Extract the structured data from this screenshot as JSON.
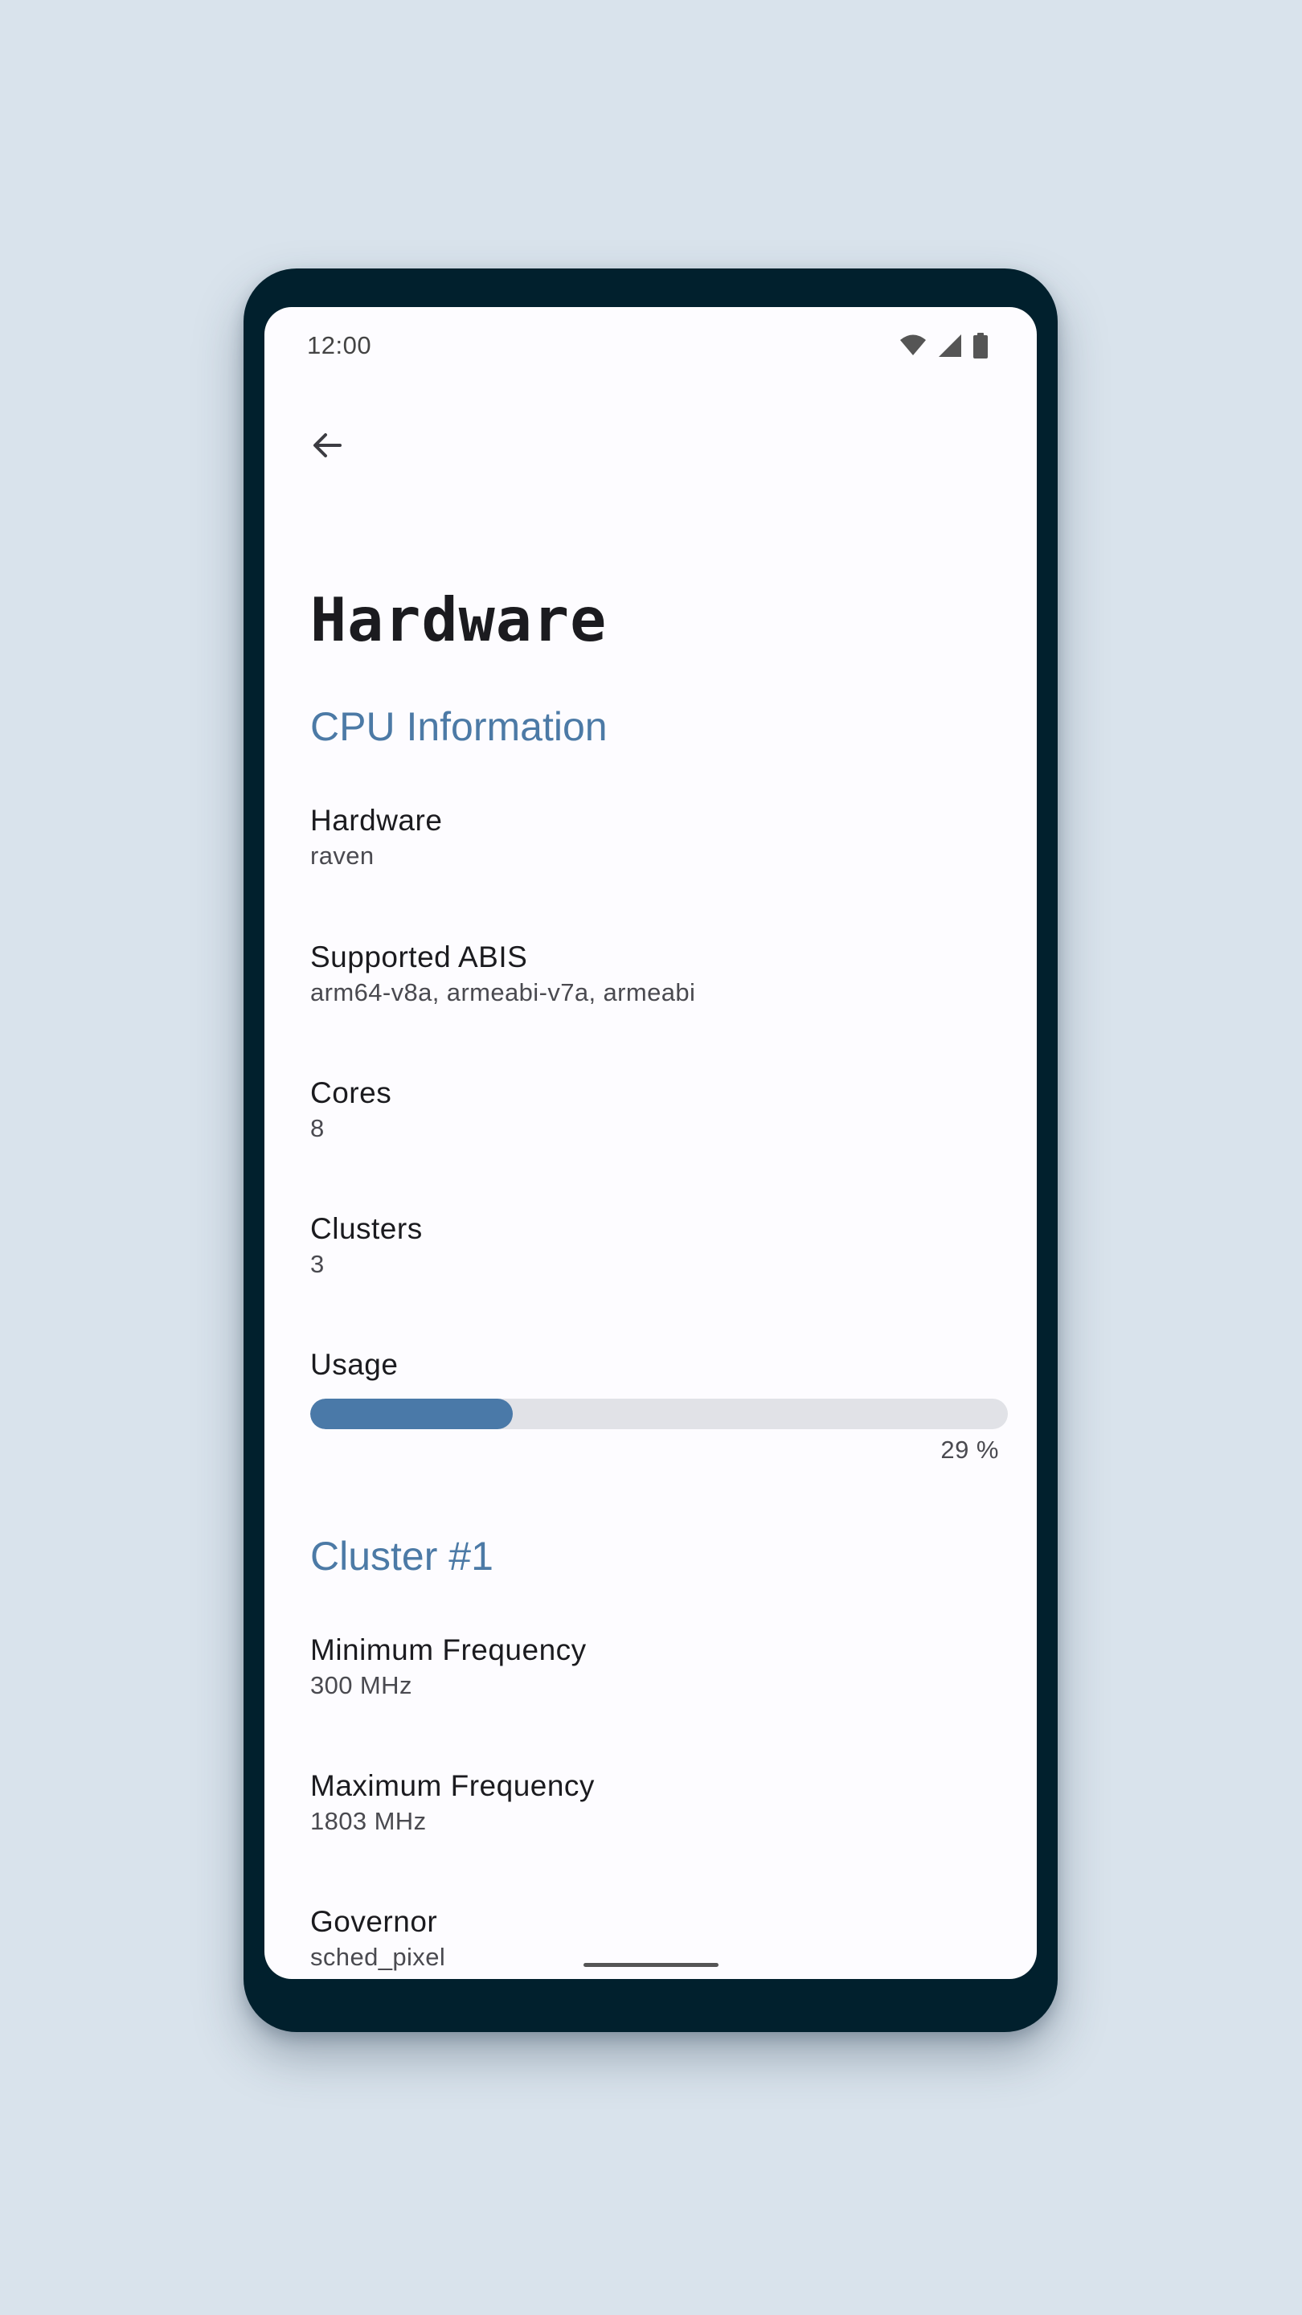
{
  "status_bar": {
    "time": "12:00",
    "icons": [
      "wifi-icon",
      "cellular-signal-icon",
      "battery-icon"
    ]
  },
  "toolbar": {
    "back_icon": "arrow-back-icon"
  },
  "page": {
    "title": "Hardware"
  },
  "sections": {
    "cpu": {
      "header": "CPU Information",
      "hardware": {
        "title": "Hardware",
        "value": "raven"
      },
      "abis": {
        "title": "Supported ABIS",
        "value": "arm64-v8a, armeabi-v7a, armeabi"
      },
      "cores": {
        "title": "Cores",
        "value": "8"
      },
      "clusters": {
        "title": "Clusters",
        "value": "3"
      },
      "usage": {
        "title": "Usage",
        "percent_label": "29 %",
        "fraction": 0.29
      }
    },
    "cluster1": {
      "header": "Cluster #1",
      "min_freq": {
        "title": "Minimum Frequency",
        "value": "300 MHz"
      },
      "max_freq": {
        "title": "Maximum Frequency",
        "value": "1803 MHz"
      },
      "governor": {
        "title": "Governor",
        "value": "sched_pixel"
      }
    }
  },
  "colors": {
    "accent": "#4c7aa6",
    "device_frame": "#01202d",
    "background": "#d9e3ec",
    "progress_fill": "#4a79a8",
    "progress_track": "#e1e2e7"
  }
}
